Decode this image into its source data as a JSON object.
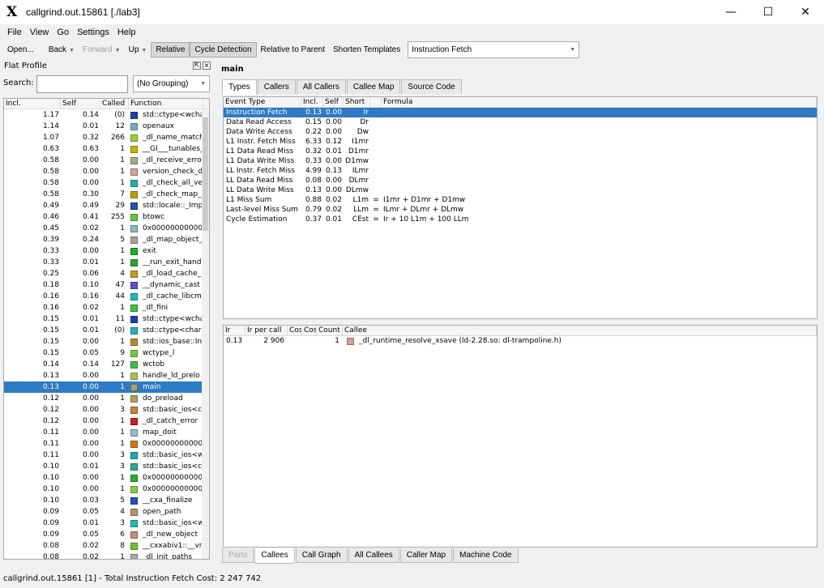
{
  "window": {
    "title": "callgrind.out.15861 [./lab3]",
    "minimize": "—",
    "maximize": "☐",
    "close": "✕"
  },
  "menu": [
    "File",
    "View",
    "Go",
    "Settings",
    "Help"
  ],
  "toolbar": {
    "open": "Open...",
    "back": "Back",
    "forward": "Forward",
    "up": "Up",
    "relative": "Relative",
    "cycle": "Cycle Detection",
    "relparent": "Relative to Parent",
    "shorten": "Shorten Templates",
    "event_combo": "Instruction Fetch"
  },
  "flat_profile": {
    "title": "Flat Profile",
    "search_label": "Search:",
    "grouping": "(No Grouping)",
    "columns": [
      "Incl.",
      "Self",
      "Called",
      "Function"
    ],
    "rows": [
      {
        "incl": "1.17",
        "self": "0.14",
        "called": "(0)",
        "func": "std::ctype<wcha",
        "color": "#1f3fb0"
      },
      {
        "incl": "1.14",
        "self": "0.01",
        "called": "12",
        "func": "openaux",
        "color": "#7aa6c2"
      },
      {
        "incl": "1.07",
        "self": "0.32",
        "called": "266",
        "func": "_dl_name_match",
        "color": "#9acd32"
      },
      {
        "incl": "0.63",
        "self": "0.63",
        "called": "1",
        "func": "__GI___tunables_",
        "color": "#c8b400"
      },
      {
        "incl": "0.58",
        "self": "0.00",
        "called": "1",
        "func": "_dl_receive_erro",
        "color": "#a0b080"
      },
      {
        "incl": "0.58",
        "self": "0.00",
        "called": "1",
        "func": "version_check_d",
        "color": "#d4a09a"
      },
      {
        "incl": "0.58",
        "self": "0.00",
        "called": "1",
        "func": "_dl_check_all_ve",
        "color": "#20b0a0"
      },
      {
        "incl": "0.58",
        "self": "0.30",
        "called": "7",
        "func": "_dl_check_map_",
        "color": "#b8a000"
      },
      {
        "incl": "0.49",
        "self": "0.49",
        "called": "29",
        "func": "std::locale::_Imp",
        "color": "#2850a8"
      },
      {
        "incl": "0.46",
        "self": "0.41",
        "called": "255",
        "func": "btowc",
        "color": "#6cc040"
      },
      {
        "incl": "0.45",
        "self": "0.02",
        "called": "1",
        "func": "0x000000000000",
        "color": "#8cb8c8"
      },
      {
        "incl": "0.39",
        "self": "0.24",
        "called": "5",
        "func": "_dl_map_object_",
        "color": "#a8a098"
      },
      {
        "incl": "0.33",
        "self": "0.00",
        "called": "1",
        "func": "exit",
        "color": "#20b020"
      },
      {
        "incl": "0.33",
        "self": "0.01",
        "called": "1",
        "func": "__run_exit_hand",
        "color": "#30a030"
      },
      {
        "incl": "0.25",
        "self": "0.06",
        "called": "4",
        "func": "_dl_load_cache_",
        "color": "#b8a020"
      },
      {
        "incl": "0.18",
        "self": "0.10",
        "called": "47",
        "func": "__dynamic_cast",
        "color": "#6050c0"
      },
      {
        "incl": "0.16",
        "self": "0.16",
        "called": "44",
        "func": "_dl_cache_libcm",
        "color": "#20b8c0"
      },
      {
        "incl": "0.16",
        "self": "0.02",
        "called": "1",
        "func": "_dl_fini",
        "color": "#40c040"
      },
      {
        "incl": "0.15",
        "self": "0.01",
        "called": "11",
        "func": "std::ctype<wcha",
        "color": "#2040b0"
      },
      {
        "incl": "0.15",
        "self": "0.01",
        "called": "(0)",
        "func": "std::ctype<char",
        "color": "#20b0b0"
      },
      {
        "incl": "0.15",
        "self": "0.00",
        "called": "1",
        "func": "std::ios_base::In",
        "color": "#b88830"
      },
      {
        "incl": "0.15",
        "self": "0.05",
        "called": "9",
        "func": "wctype_l",
        "color": "#78c840"
      },
      {
        "incl": "0.14",
        "self": "0.14",
        "called": "127",
        "func": "wctob",
        "color": "#48b848"
      },
      {
        "incl": "0.13",
        "self": "0.00",
        "called": "1",
        "func": "handle_ld_prelo",
        "color": "#a8c060"
      },
      {
        "incl": "0.13",
        "self": "0.00",
        "called": "1",
        "func": "main",
        "color": "#a0a070",
        "selected": true
      },
      {
        "incl": "0.12",
        "self": "0.00",
        "called": "1",
        "func": "do_preload",
        "color": "#b0a060"
      },
      {
        "incl": "0.12",
        "self": "0.00",
        "called": "3",
        "func": "std::basic_ios<c",
        "color": "#c88040"
      },
      {
        "incl": "0.12",
        "self": "0.00",
        "called": "1",
        "func": "_dl_catch_error",
        "color": "#c82020"
      },
      {
        "incl": "0.11",
        "self": "0.00",
        "called": "1",
        "func": "map_doit",
        "color": "#98b8d0"
      },
      {
        "incl": "0.11",
        "self": "0.00",
        "called": "1",
        "func": "0x000000000000",
        "color": "#d07818"
      },
      {
        "incl": "0.11",
        "self": "0.00",
        "called": "3",
        "func": "std::basic_ios<w",
        "color": "#20a8b0"
      },
      {
        "incl": "0.10",
        "self": "0.01",
        "called": "3",
        "func": "std::basic_ios<c",
        "color": "#30a890"
      },
      {
        "incl": "0.10",
        "self": "0.00",
        "called": "1",
        "func": "0x000000000000",
        "color": "#28b030"
      },
      {
        "incl": "0.10",
        "self": "0.00",
        "called": "1",
        "func": "0x000000000000",
        "color": "#88c840"
      },
      {
        "incl": "0.10",
        "self": "0.03",
        "called": "5",
        "func": "__cxa_finalize",
        "color": "#2050c8"
      },
      {
        "incl": "0.09",
        "self": "0.05",
        "called": "4",
        "func": "open_path",
        "color": "#b89070"
      },
      {
        "incl": "0.09",
        "self": "0.01",
        "called": "3",
        "func": "std::basic_ios<w",
        "color": "#20b8b8"
      },
      {
        "incl": "0.09",
        "self": "0.05",
        "called": "6",
        "func": "_dl_new_object",
        "color": "#c09070"
      },
      {
        "incl": "0.08",
        "self": "0.02",
        "called": "8",
        "func": "__cxxabiv1::__vr",
        "color": "#70c030"
      },
      {
        "incl": "0.08",
        "self": "0.02",
        "called": "1",
        "func": "_dl_init_paths",
        "color": "#a8a8a8"
      }
    ]
  },
  "detail": {
    "title": "main",
    "top_tabs": [
      "Types",
      "Callers",
      "All Callers",
      "Callee Map",
      "Source Code"
    ],
    "types_columns": [
      "Event Type",
      "Incl.",
      "Self",
      "Short",
      "",
      "Formula"
    ],
    "types_rows": [
      {
        "type": "Instruction Fetch",
        "incl": "0.13",
        "self": "0.00",
        "short": "Ir",
        "eq": "",
        "formula": "",
        "selected": true
      },
      {
        "type": "Data Read Access",
        "incl": "0.15",
        "self": "0.00",
        "short": "Dr",
        "eq": "",
        "formula": ""
      },
      {
        "type": "Data Write Access",
        "incl": "0.22",
        "self": "0.00",
        "short": "Dw",
        "eq": "",
        "formula": ""
      },
      {
        "type": "L1 Instr. Fetch Miss",
        "incl": "6.33",
        "self": "0.12",
        "short": "I1mr",
        "eq": "",
        "formula": ""
      },
      {
        "type": "L1 Data Read Miss",
        "incl": "0.32",
        "self": "0.01",
        "short": "D1mr",
        "eq": "",
        "formula": ""
      },
      {
        "type": "L1 Data Write Miss",
        "incl": "0.33",
        "self": "0.00",
        "short": "D1mw",
        "eq": "",
        "formula": ""
      },
      {
        "type": "LL Instr. Fetch Miss",
        "incl": "4.99",
        "self": "0.13",
        "short": "ILmr",
        "eq": "",
        "formula": ""
      },
      {
        "type": "LL Data Read Miss",
        "incl": "0.08",
        "self": "0.00",
        "short": "DLmr",
        "eq": "",
        "formula": ""
      },
      {
        "type": "LL Data Write Miss",
        "incl": "0.13",
        "self": "0.00",
        "short": "DLmw",
        "eq": "",
        "formula": ""
      },
      {
        "type": "L1 Miss Sum",
        "incl": "0.88",
        "self": "0.02",
        "short": "L1m",
        "eq": "=",
        "formula": "I1mr + D1mr + D1mw"
      },
      {
        "type": "Last-level Miss Sum",
        "incl": "0.79",
        "self": "0.02",
        "short": "LLm",
        "eq": "=",
        "formula": "ILmr + DLmr + DLmw"
      },
      {
        "type": "Cycle Estimation",
        "incl": "0.37",
        "self": "0.01",
        "short": "CEst",
        "eq": "=",
        "formula": "Ir + 10 L1m + 100 LLm"
      }
    ],
    "callee_columns": [
      "Ir",
      "Ir per call",
      "Cos",
      "Cos",
      "Count",
      "Callee"
    ],
    "callee_rows": [
      {
        "ir": "0.13",
        "per_call": "2 906",
        "c1": "",
        "c2": "",
        "count": "1",
        "callee": "_dl_runtime_resolve_xsave (ld-2.28.so: dl-trampoline.h)",
        "color": "#d4a09a"
      }
    ],
    "bottom_tabs": [
      "Parts",
      "Callees",
      "Call Graph",
      "All Callees",
      "Caller Map",
      "Machine Code"
    ]
  },
  "status": "callgrind.out.15861 [1] - Total Instruction Fetch Cost: 2 247 742"
}
